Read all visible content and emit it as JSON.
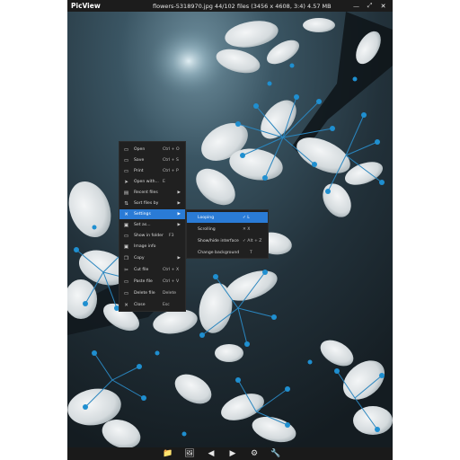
{
  "window": {
    "app_name": "PicView",
    "file_title": "flowers-5318970.jpg 44/102 files (3456 x 4608, 3:4) 4.57 MB",
    "buttons": {
      "minimize": "—",
      "maximize": "⤢",
      "close": "✕"
    }
  },
  "context_menu": {
    "items": [
      {
        "icon": "open-icon",
        "glyph": "▭",
        "label": "Open",
        "shortcut": "Ctrl + O",
        "arrow": ""
      },
      {
        "icon": "save-icon",
        "glyph": "▭",
        "label": "Save",
        "shortcut": "Ctrl + S",
        "arrow": ""
      },
      {
        "icon": "print-icon",
        "glyph": "▭",
        "label": "Print",
        "shortcut": "Ctrl + P",
        "arrow": ""
      },
      {
        "icon": "open-with-icon",
        "glyph": "➤",
        "label": "Open with...",
        "shortcut": "E",
        "arrow": ""
      },
      {
        "icon": "recent-files-icon",
        "glyph": "▤",
        "label": "Recent files",
        "shortcut": "",
        "arrow": "▶"
      },
      {
        "icon": "sort-icon",
        "glyph": "⇅",
        "label": "Sort files by",
        "shortcut": "",
        "arrow": "▶"
      },
      {
        "icon": "settings-icon",
        "glyph": "✕",
        "label": "Settings",
        "shortcut": "",
        "arrow": "▶"
      },
      {
        "icon": "set-as-icon",
        "glyph": "▣",
        "label": "Set as...",
        "shortcut": "",
        "arrow": "▶"
      },
      {
        "icon": "folder-icon",
        "glyph": "▭",
        "label": "Show in folder",
        "shortcut": "F3",
        "arrow": ""
      },
      {
        "icon": "image-info-icon",
        "glyph": "▣",
        "label": "Image info",
        "shortcut": "",
        "arrow": ""
      },
      {
        "icon": "copy-icon",
        "glyph": "❐",
        "label": "Copy",
        "shortcut": "",
        "arrow": "▶"
      },
      {
        "icon": "cut-icon",
        "glyph": "✂",
        "label": "Cut file",
        "shortcut": "Ctrl + X",
        "arrow": ""
      },
      {
        "icon": "paste-icon",
        "glyph": "▭",
        "label": "Paste file",
        "shortcut": "Ctrl + V",
        "arrow": ""
      },
      {
        "icon": "delete-icon",
        "glyph": "▭",
        "label": "Delete file",
        "shortcut": "Delete",
        "arrow": ""
      },
      {
        "icon": "close-icon",
        "glyph": "✕",
        "label": "Close",
        "shortcut": "Esc",
        "arrow": ""
      }
    ]
  },
  "settings_submenu": {
    "items": [
      {
        "label": "Looping",
        "shortcut": "✓ L"
      },
      {
        "label": "Scrolling",
        "shortcut": "✕ X"
      },
      {
        "label": "Show/hide interface",
        "shortcut": "✓ Alt + Z"
      },
      {
        "label": "Change background",
        "shortcut": "T"
      }
    ]
  },
  "bottom_bar": {
    "icons": [
      {
        "name": "open-folder-icon",
        "glyph": "📁"
      },
      {
        "name": "gallery-icon",
        "glyph": "🖼"
      },
      {
        "name": "previous-icon",
        "glyph": "◀"
      },
      {
        "name": "next-icon",
        "glyph": "▶"
      },
      {
        "name": "settings-gear-icon",
        "glyph": "⚙"
      },
      {
        "name": "tools-icon",
        "glyph": "🔧"
      }
    ]
  },
  "colors": {
    "accent": "#2a7bd6",
    "menu_bg": "#202020",
    "titlebar_bg": "#1c1c1c",
    "flower_blue": "#1f8fd0",
    "petal_white": "#e4e8ea"
  }
}
